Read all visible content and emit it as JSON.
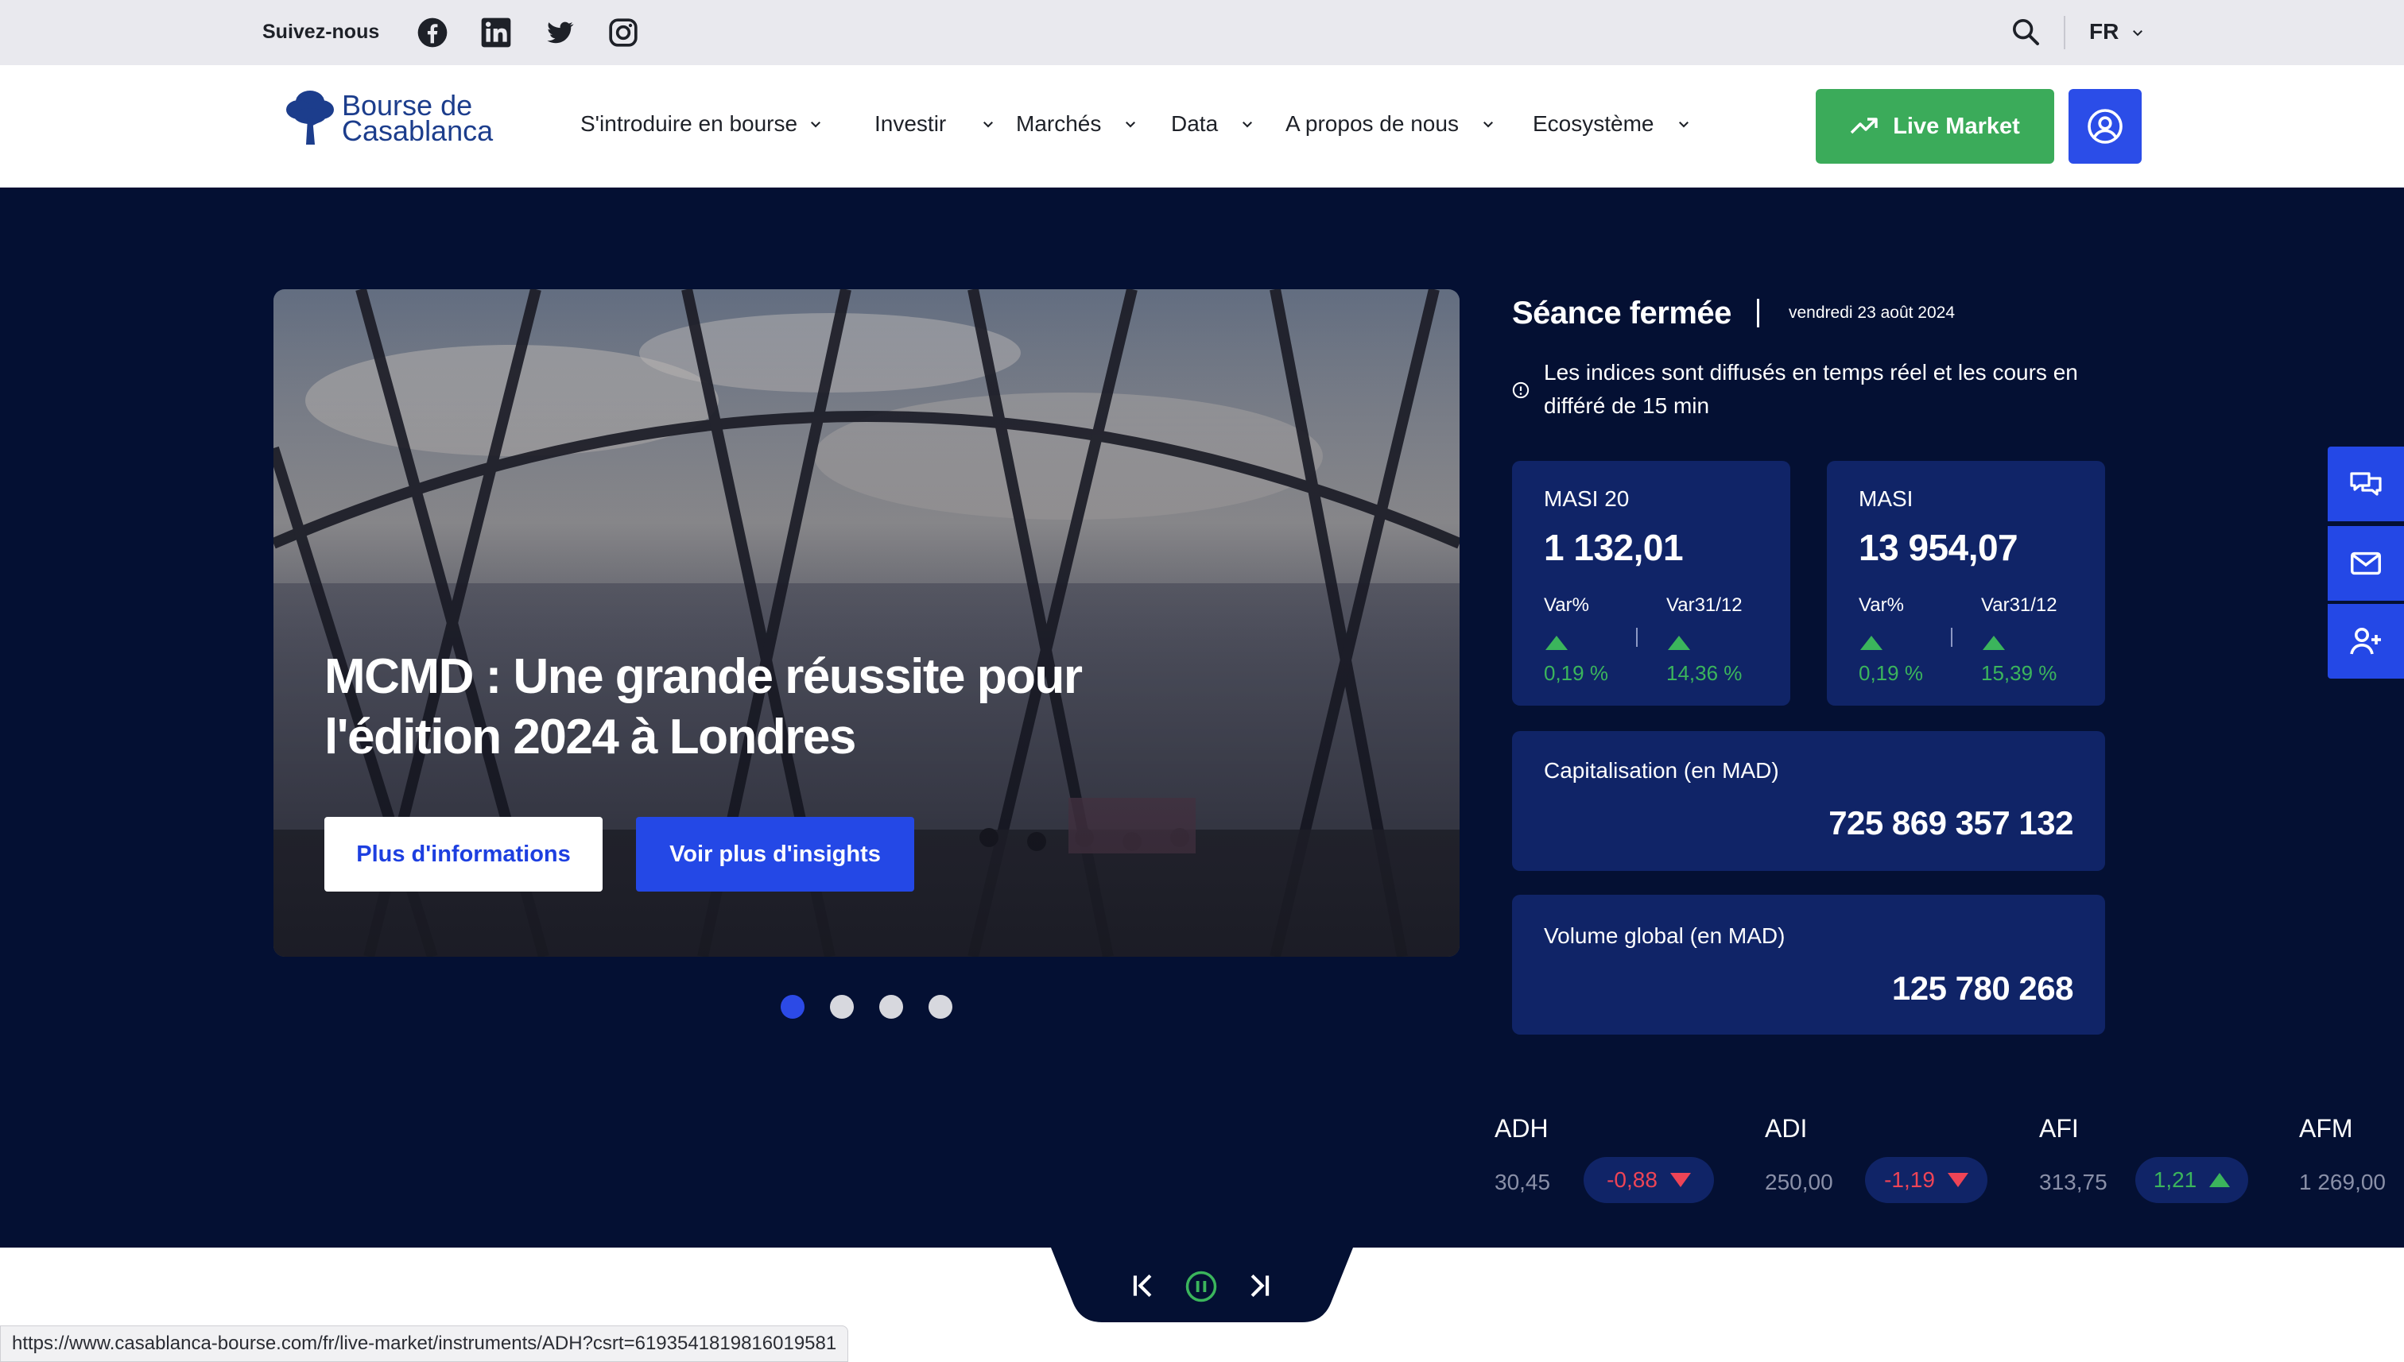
{
  "topbar": {
    "follow_label": "Suivez-nous",
    "social_icons": [
      "facebook-icon",
      "linkedin-icon",
      "twitter-icon",
      "instagram-icon"
    ],
    "language": "FR"
  },
  "header": {
    "logo_line1": "Bourse de",
    "logo_line2": "Casablanca",
    "nav": [
      {
        "label": "S'introduire en bourse"
      },
      {
        "label": "Investir"
      },
      {
        "label": "Marchés"
      },
      {
        "label": "Data"
      },
      {
        "label": "A propos de nous"
      },
      {
        "label": "Ecosystème"
      }
    ],
    "live_market_label": "Live Market"
  },
  "hero": {
    "slide_title": "MCMD : Une grande réussite pour l'édition 2024 à Londres",
    "more_info_label": "Plus d'informations",
    "more_insights_label": "Voir plus d'insights",
    "slide_count": 4,
    "active_slide": 1
  },
  "session": {
    "status": "Séance fermée",
    "date": "vendredi 23 août 2024",
    "info": "Les indices sont diffusés en temps réel et les cours en différé de 15 min"
  },
  "indices": [
    {
      "name": "MASI 20",
      "value": "1 132,01",
      "var_label": "Var%",
      "var": "0,19 %",
      "var3112_label": "Var31/12",
      "var3112": "14,36 %"
    },
    {
      "name": "MASI",
      "value": "13 954,07",
      "var_label": "Var%",
      "var": "0,19 %",
      "var3112_label": "Var31/12",
      "var3112": "15,39 %"
    }
  ],
  "capitalisation": {
    "label": "Capitalisation (en MAD)",
    "value": "725 869 357 132"
  },
  "volume": {
    "label": "Volume global (en MAD)",
    "value": "125 780 268"
  },
  "ticker": [
    {
      "symbol": "ADH",
      "price": "30,45",
      "change": "-0,88",
      "direction": "down"
    },
    {
      "symbol": "ADI",
      "price": "250,00",
      "change": "-1,19",
      "direction": "down"
    },
    {
      "symbol": "AFI",
      "price": "313,75",
      "change": "1,21",
      "direction": "up"
    },
    {
      "symbol": "AFM",
      "price": "1 269,00"
    }
  ],
  "status_url": "https://www.casablanca-bourse.com/fr/live-market/instruments/ADH?csrt=6193541819816019581",
  "colors": {
    "navy": "#041033",
    "card": "#102467",
    "accent_blue": "#2448e6",
    "green": "#3bab5a",
    "red": "#ee4456"
  }
}
